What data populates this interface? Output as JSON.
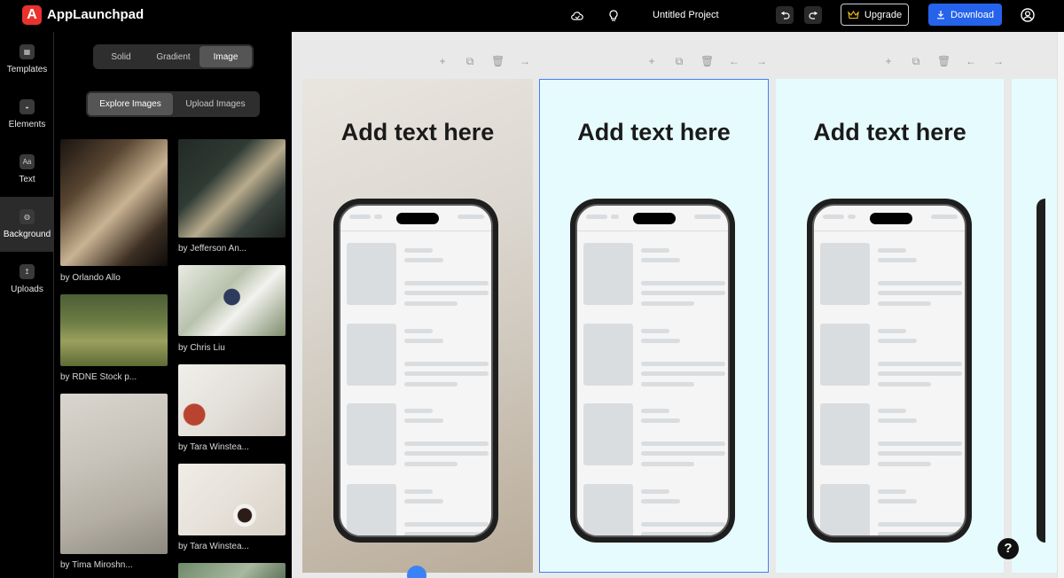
{
  "app": {
    "logo_letter": "A",
    "name": "AppLaunchpad",
    "project_title": "Untitled Project"
  },
  "topbar": {
    "upgrade_label": "Upgrade",
    "download_label": "Download"
  },
  "sidebar": {
    "items": [
      {
        "label": "Templates",
        "icon": "templates-icon"
      },
      {
        "label": "Elements",
        "icon": "elements-icon"
      },
      {
        "label": "Text",
        "icon": "text-icon",
        "glyph": "Aa"
      },
      {
        "label": "Background",
        "icon": "background-icon",
        "active": true
      },
      {
        "label": "Uploads",
        "icon": "uploads-icon"
      }
    ]
  },
  "panel": {
    "bg_tabs": [
      "Solid",
      "Gradient",
      "Image"
    ],
    "bg_tab_active": "Image",
    "image_tabs": [
      "Explore Images",
      "Upload Images"
    ],
    "image_tab_active": "Explore Images",
    "images": [
      {
        "credit": "by Orlando Allo"
      },
      {
        "credit": "by Jefferson An..."
      },
      {
        "credit": "by Chris Liu"
      },
      {
        "credit": "by RDNE Stock p..."
      },
      {
        "credit": "by Tara Winstea..."
      },
      {
        "credit": "by Tara Winstea..."
      },
      {
        "credit": "by Tima Miroshn..."
      }
    ]
  },
  "canvas": {
    "frames": [
      {
        "title": "Add text here",
        "background": "image",
        "selected": true
      },
      {
        "title": "Add text here",
        "background": "#e6fbfd",
        "selected": true
      },
      {
        "title": "Add text here",
        "background": "#e6fbfd",
        "selected": false
      }
    ],
    "help_label": "?",
    "colors": {
      "accent": "#2563eb",
      "selection": "#3b82f6",
      "frame_bg": "#e6fbfd",
      "color_swatch": "#c084fc"
    }
  }
}
